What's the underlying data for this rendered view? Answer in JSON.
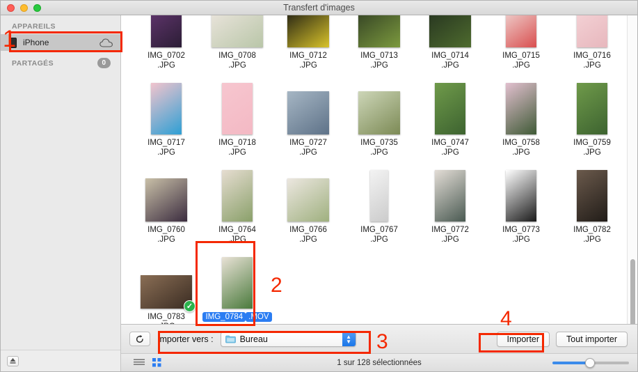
{
  "window": {
    "title": "Transfert d'images",
    "traffic_lights": [
      "close",
      "minimize",
      "zoom"
    ]
  },
  "sidebar": {
    "sections": [
      {
        "header": "APPAREILS",
        "items": [
          {
            "label": "iPhone",
            "icon": "iphone-icon",
            "accessory": "cloud-icon",
            "selected": true
          }
        ]
      },
      {
        "header": "PARTAGÉS",
        "badge": "0",
        "items": []
      }
    ],
    "eject_icon": "eject-icon"
  },
  "grid": {
    "items": [
      {
        "name": "IMG_0702",
        "ext": ".JPG",
        "orientation": "portrait",
        "c1": "#6d3b7a",
        "c2": "#2b1d35",
        "selected": false,
        "checked": false
      },
      {
        "name": "IMG_0708",
        "ext": ".JPG",
        "orientation": "landscape",
        "c1": "#e8e3da",
        "c2": "#b9c6a8",
        "selected": false,
        "checked": false
      },
      {
        "name": "IMG_0712",
        "ext": ".JPG",
        "orientation": "square",
        "c1": "#121212",
        "c2": "#d8c32a",
        "selected": false,
        "checked": false
      },
      {
        "name": "IMG_0713",
        "ext": ".JPG",
        "orientation": "square",
        "c1": "#2d3a22",
        "c2": "#7c9a3e",
        "selected": false,
        "checked": false
      },
      {
        "name": "IMG_0714",
        "ext": ".JPG",
        "orientation": "square",
        "c1": "#23301f",
        "c2": "#4e6b2e",
        "selected": false,
        "checked": false
      },
      {
        "name": "IMG_0715",
        "ext": ".JPG",
        "orientation": "portrait",
        "c1": "#f4f1ee",
        "c2": "#d94f4f",
        "selected": false,
        "checked": false
      },
      {
        "name": "IMG_0716",
        "ext": ".JPG",
        "orientation": "portrait",
        "c1": "#f7d9dc",
        "c2": "#e7b7bd",
        "selected": false,
        "checked": false
      },
      {
        "name": "IMG_0717",
        "ext": ".JPG",
        "orientation": "portrait",
        "c1": "#f2c4cd",
        "c2": "#2e9fd4",
        "selected": false,
        "checked": false
      },
      {
        "name": "IMG_0718",
        "ext": ".JPG",
        "orientation": "portrait",
        "c1": "#f6c6cf",
        "c2": "#f4b9c4",
        "selected": false,
        "checked": false
      },
      {
        "name": "IMG_0727",
        "ext": ".JPG",
        "orientation": "square",
        "c1": "#a6b6c4",
        "c2": "#5e7288",
        "selected": false,
        "checked": false
      },
      {
        "name": "IMG_0735",
        "ext": ".JPG",
        "orientation": "square",
        "c1": "#cdd6b8",
        "c2": "#7c8a55",
        "selected": false,
        "checked": false
      },
      {
        "name": "IMG_0747",
        "ext": ".JPG",
        "orientation": "portrait",
        "c1": "#6f9a4a",
        "c2": "#3d6330",
        "selected": false,
        "checked": false
      },
      {
        "name": "IMG_0758",
        "ext": ".JPG",
        "orientation": "portrait",
        "c1": "#e2c0cf",
        "c2": "#3f5a36",
        "selected": false,
        "checked": false
      },
      {
        "name": "IMG_0759",
        "ext": ".JPG",
        "orientation": "portrait",
        "c1": "#6f9a4a",
        "c2": "#3d6330",
        "selected": false,
        "checked": false
      },
      {
        "name": "IMG_0760",
        "ext": ".JPG",
        "orientation": "square",
        "c1": "#c9c0a8",
        "c2": "#3b2c3f",
        "selected": false,
        "checked": false
      },
      {
        "name": "IMG_0764",
        "ext": ".JPG",
        "orientation": "portrait",
        "c1": "#e6ddd1",
        "c2": "#8aa06a",
        "selected": false,
        "checked": false
      },
      {
        "name": "IMG_0766",
        "ext": ".JPG",
        "orientation": "square",
        "c1": "#ece7e0",
        "c2": "#9fb07f",
        "selected": false,
        "checked": false
      },
      {
        "name": "IMG_0767",
        "ext": ".JPG",
        "orientation": "tall",
        "c1": "#f3f3f3",
        "c2": "#cccccc",
        "selected": false,
        "checked": false
      },
      {
        "name": "IMG_0772",
        "ext": ".JPG",
        "orientation": "portrait",
        "c1": "#e3ddd6",
        "c2": "#4a5a52",
        "selected": false,
        "checked": false
      },
      {
        "name": "IMG_0773",
        "ext": ".JPG",
        "orientation": "portrait",
        "c1": "#ffffff",
        "c2": "#1a1a1a",
        "selected": false,
        "checked": false
      },
      {
        "name": "IMG_0782",
        "ext": ".JPG",
        "orientation": "portrait",
        "c1": "#6b5a4c",
        "c2": "#211c18",
        "selected": false,
        "checked": false
      },
      {
        "name": "IMG_0783",
        "ext": ".JPG",
        "orientation": "landscape",
        "c1": "#8a6e55",
        "c2": "#3a2c22",
        "selected": false,
        "checked": true
      },
      {
        "name": "IMG_0784",
        "ext": ".MOV",
        "orientation": "portrait",
        "c1": "#e9e2d6",
        "c2": "#4a7a3c",
        "selected": true,
        "checked": false
      }
    ]
  },
  "import_bar": {
    "rotate_icon": "rotate-ccw-icon",
    "import_to_label": "Importer vers :",
    "destination": "Bureau",
    "destination_icon": "folder-icon",
    "import_button": "Importer",
    "import_all_button": "Tout importer"
  },
  "status_bar": {
    "list_view_icon": "list-view-icon",
    "grid_view_icon": "grid-view-icon",
    "selection_text": "1 sur 128 sélectionnées",
    "zoom_slider_value": 45
  },
  "annotations": [
    {
      "label": "1",
      "kind": "bracket"
    },
    {
      "label": "2",
      "kind": "number"
    },
    {
      "label": "3",
      "kind": "number"
    },
    {
      "label": "4",
      "kind": "number"
    }
  ],
  "colors": {
    "annotation_red": "#f42800",
    "selection_blue": "#2b7df2",
    "check_green": "#2bb24c"
  }
}
